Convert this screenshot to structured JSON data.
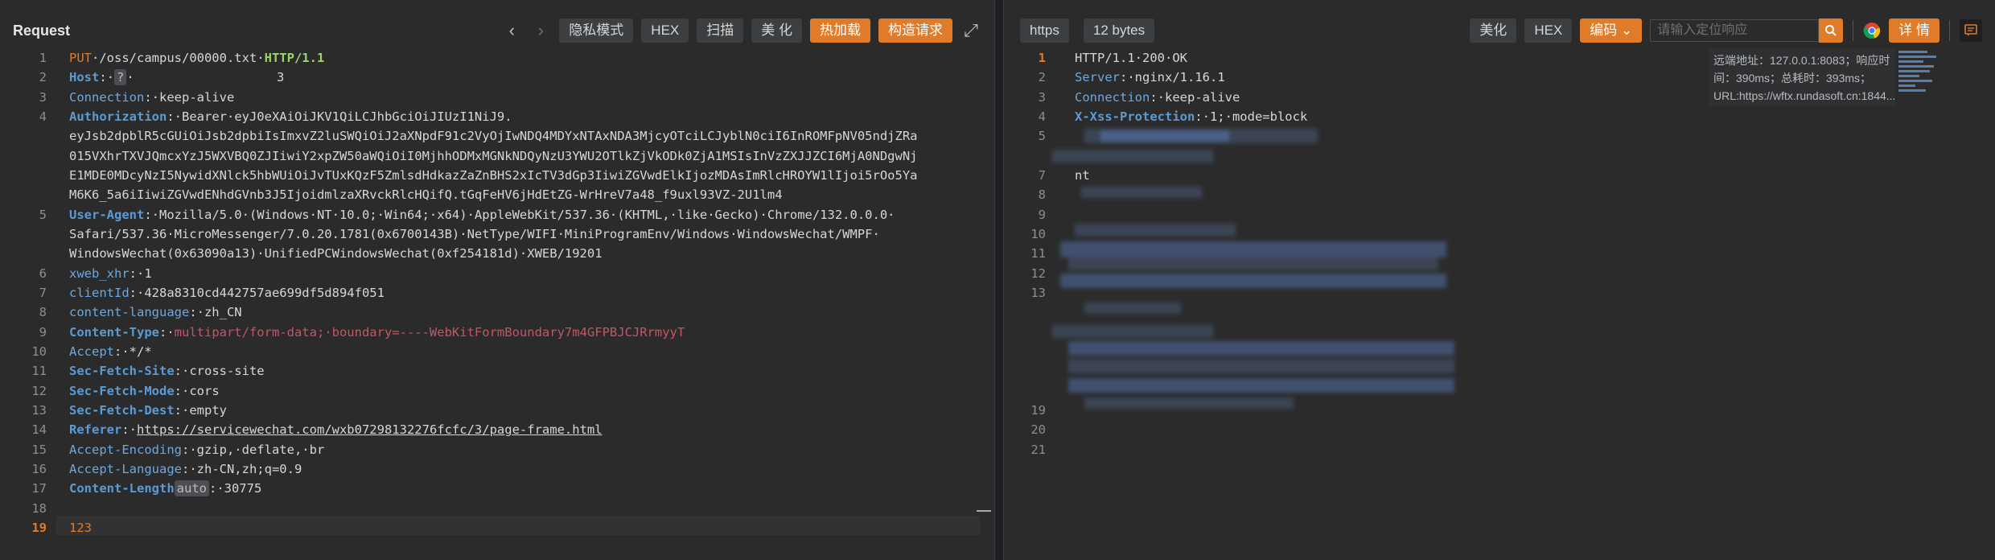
{
  "request": {
    "title": "Request",
    "toolbar": {
      "prev": "‹",
      "next": "›",
      "private_mode": "隐私模式",
      "hex": "HEX",
      "scan": "扫描",
      "beautify": "美 化",
      "hot_load": "热加载",
      "build_request": "构造请求",
      "expand": "⤢"
    },
    "lines": [
      {
        "n": "1",
        "parts": [
          {
            "c": "m",
            "t": "PUT"
          },
          {
            "c": "",
            "t": "·/oss/campus/00000.txt·"
          },
          {
            "c": "proto",
            "t": "HTTP/1.1"
          }
        ]
      },
      {
        "n": "2",
        "parts": [
          {
            "c": "k",
            "t": "Host"
          },
          {
            "c": "",
            "t": ":·"
          },
          {
            "c": "badge",
            "t": "?"
          },
          {
            "c": "",
            "t": "·                   3"
          }
        ]
      },
      {
        "n": "3",
        "parts": [
          {
            "c": "k2",
            "t": "Connection"
          },
          {
            "c": "",
            "t": ":·keep-alive"
          }
        ]
      },
      {
        "n": "4",
        "parts": [
          {
            "c": "k",
            "t": "Authorization"
          },
          {
            "c": "",
            "t": ":·Bearer·eyJ0eXAiOiJKV1QiLCJhbGciOiJIUzI1NiJ9."
          }
        ]
      },
      {
        "n": "",
        "parts": [
          {
            "c": "",
            "t": "eyJsb2dpblR5cGUiOiJsb2dpbiIsImxvZ2luSWQiOiJ2aXNpdF91c2VyOjIwNDQ4MDYxNTAxNDA3MjcyOTciLCJyblN0ciI6InROMFpNV05ndjZRa"
          }
        ]
      },
      {
        "n": "",
        "parts": [
          {
            "c": "",
            "t": "015VXhrTXVJQmcxYzJ5WXVBQ0ZJIiwiY2xpZW50aWQiOiI0MjhhODMxMGNkNDQyNzU3YWU2OTlkZjVkODk0ZjA1MSIsInVzZXJJZCI6MjA0NDgwNj"
          }
        ]
      },
      {
        "n": "",
        "parts": [
          {
            "c": "",
            "t": "E1MDE0MDcyNzI5NywidXNlck5hbWUiOiJvTUxKQzF5ZmlsdHdkazZaZnBHS2xIcTV3dGp3IiwiZGVwdElkIjozMDAsImRlcHROYW1lIjoi5rOo5Ya"
          }
        ]
      },
      {
        "n": "",
        "parts": [
          {
            "c": "",
            "t": "M6K6_5a6iIiwiZGVwdENhdGVnb3J5IjoidmlzaXRvckRlcHQifQ.tGqFeHV6jHdEtZG-WrHreV7a48_f9uxl93VZ-2U1lm4"
          }
        ]
      },
      {
        "n": "5",
        "parts": [
          {
            "c": "k",
            "t": "User-Agent"
          },
          {
            "c": "",
            "t": ":·Mozilla/5.0·(Windows·NT·10.0;·Win64;·x64)·AppleWebKit/537.36·(KHTML,·like·Gecko)·Chrome/132.0.0.0·"
          }
        ]
      },
      {
        "n": "",
        "parts": [
          {
            "c": "",
            "t": "Safari/537.36·MicroMessenger/7.0.20.1781(0x6700143B)·NetType/WIFI·MiniProgramEnv/Windows·WindowsWechat/WMPF·"
          }
        ]
      },
      {
        "n": "",
        "parts": [
          {
            "c": "",
            "t": "WindowsWechat(0x63090a13)·UnifiedPCWindowsWechat(0xf254181d)·XWEB/19201"
          }
        ]
      },
      {
        "n": "6",
        "parts": [
          {
            "c": "k2",
            "t": "xweb_xhr"
          },
          {
            "c": "",
            "t": ":·1"
          }
        ]
      },
      {
        "n": "7",
        "parts": [
          {
            "c": "k2",
            "t": "clientId"
          },
          {
            "c": "",
            "t": ":·428a8310cd442757ae699df5d894f051"
          }
        ]
      },
      {
        "n": "8",
        "parts": [
          {
            "c": "k2",
            "t": "content-language"
          },
          {
            "c": "",
            "t": ":·zh_CN"
          }
        ]
      },
      {
        "n": "9",
        "parts": [
          {
            "c": "k",
            "t": "Content-Type"
          },
          {
            "c": "",
            "t": ":·"
          },
          {
            "c": "red",
            "t": "multipart/form-data;·boundary=----WebKitFormBoundary7m4GFPBJCJRrmyyT"
          }
        ]
      },
      {
        "n": "10",
        "parts": [
          {
            "c": "k2",
            "t": "Accept"
          },
          {
            "c": "",
            "t": ":·*/*"
          }
        ]
      },
      {
        "n": "11",
        "parts": [
          {
            "c": "k",
            "t": "Sec-Fetch-Site"
          },
          {
            "c": "",
            "t": ":·cross-site"
          }
        ]
      },
      {
        "n": "12",
        "parts": [
          {
            "c": "k",
            "t": "Sec-Fetch-Mode"
          },
          {
            "c": "",
            "t": ":·cors"
          }
        ]
      },
      {
        "n": "13",
        "parts": [
          {
            "c": "k",
            "t": "Sec-Fetch-Dest"
          },
          {
            "c": "",
            "t": ":·empty"
          }
        ]
      },
      {
        "n": "14",
        "parts": [
          {
            "c": "k",
            "t": "Referer"
          },
          {
            "c": "",
            "t": ":·"
          },
          {
            "c": "link",
            "t": "https://servicewechat.com/wxb07298132276fcfc/3/page-frame.html"
          }
        ]
      },
      {
        "n": "15",
        "parts": [
          {
            "c": "k2",
            "t": "Accept-Encoding"
          },
          {
            "c": "",
            "t": ":·gzip,·deflate,·br"
          }
        ]
      },
      {
        "n": "16",
        "parts": [
          {
            "c": "k2",
            "t": "Accept-Language"
          },
          {
            "c": "",
            "t": ":·zh-CN,zh;q=0.9"
          }
        ]
      },
      {
        "n": "17",
        "parts": [
          {
            "c": "k",
            "t": "Content-Length"
          },
          {
            "c": "badge",
            "t": "auto"
          },
          {
            "c": "",
            "t": ":·30775"
          }
        ]
      },
      {
        "n": "18",
        "parts": []
      },
      {
        "n": "19",
        "cur": true,
        "parts": [
          {
            "c": "m",
            "t": "123"
          }
        ]
      }
    ]
  },
  "response": {
    "protocol_tag": "https",
    "size_tag": "12 bytes",
    "toolbar": {
      "beautify": "美化",
      "hex": "HEX",
      "encoding": "编码",
      "search_placeholder": "请输入定位响应",
      "details": "详 情"
    },
    "tooltip": "远端地址：127.0.0.1:8083；响应时间：390ms；总耗时：393ms；URL:https://wftx.rundasoft.cn:1844...",
    "lines": [
      {
        "n": "1",
        "cur": true,
        "parts": [
          {
            "c": "",
            "t": "HTTP/1.1·200·OK"
          }
        ]
      },
      {
        "n": "2",
        "parts": [
          {
            "c": "k2",
            "t": "Server"
          },
          {
            "c": "",
            "t": ":·nginx/1.16.1"
          }
        ]
      },
      {
        "n": "3",
        "parts": [
          {
            "c": "k2",
            "t": "Connection"
          },
          {
            "c": "",
            "t": ":·keep-alive"
          }
        ]
      },
      {
        "n": "4",
        "parts": [
          {
            "c": "k",
            "t": "X-Xss-Protection"
          },
          {
            "c": "",
            "t": ":·1;·mode=block"
          }
        ]
      },
      {
        "n": "5",
        "parts": []
      },
      {
        "n": "",
        "parts": []
      },
      {
        "n": "7",
        "parts": [
          {
            "c": "",
            "t": "nt"
          }
        ]
      },
      {
        "n": "8",
        "parts": []
      },
      {
        "n": "9",
        "parts": []
      },
      {
        "n": "10",
        "parts": []
      },
      {
        "n": "11",
        "parts": []
      },
      {
        "n": "12",
        "parts": []
      },
      {
        "n": "13",
        "parts": []
      },
      {
        "n": "",
        "parts": []
      },
      {
        "n": "",
        "parts": []
      },
      {
        "n": "",
        "parts": []
      },
      {
        "n": "",
        "parts": []
      },
      {
        "n": "",
        "parts": []
      },
      {
        "n": "19",
        "parts": []
      },
      {
        "n": "20",
        "parts": []
      },
      {
        "n": "21",
        "parts": []
      }
    ]
  },
  "icons": {
    "chrome": "chrome-icon",
    "comment": "comment-icon",
    "search": "search-icon"
  }
}
